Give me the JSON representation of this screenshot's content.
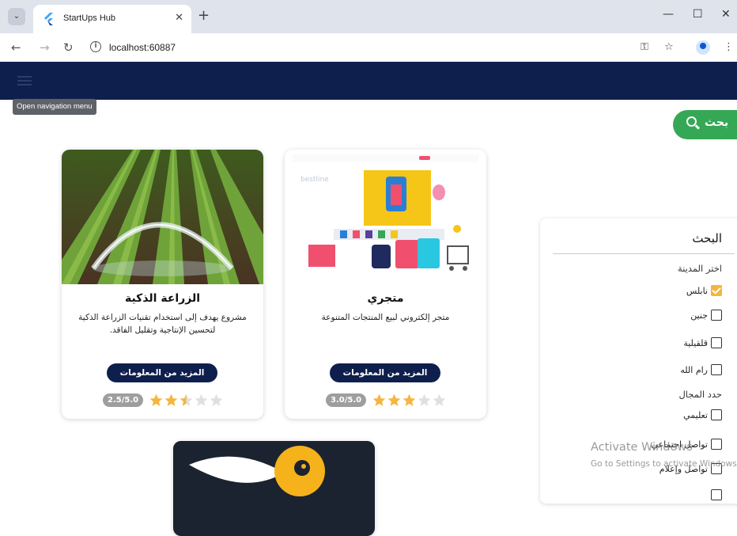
{
  "browser": {
    "tab_title": "StartUps Hub",
    "url": "localhost:60887"
  },
  "appbar": {
    "tooltip": "Open navigation menu"
  },
  "search": {
    "button_label": "بحث"
  },
  "cards": [
    {
      "title": "الزراعة الذكية",
      "description": "مشروع يهدف إلى استخدام تقنيات الزراعة الذكية لتحسين الإنتاجية وتقليل الفاقد.",
      "button": "المزيد من المعلومات",
      "rating_text": "2.5/5.0",
      "rating": 2.5
    },
    {
      "title": "متجري",
      "description": "متجر إلكتروني لبيع المنتجات المتنوعة",
      "button": "المزيد من المعلومات",
      "rating_text": "3.0/5.0",
      "rating": 3.0
    }
  ],
  "filters": {
    "title": "البحث",
    "city_label": "اختر المدينة",
    "cities": [
      {
        "label": "نابلس",
        "checked": true
      },
      {
        "label": "جنين",
        "checked": false
      },
      {
        "label": "قلقيلية",
        "checked": false
      },
      {
        "label": "رام الله",
        "checked": false
      }
    ],
    "field_label": "حدد المجال",
    "fields": [
      {
        "label": "تعليمي",
        "checked": false
      },
      {
        "label": "تواصل اجتماعي",
        "checked": false
      },
      {
        "label": "تواصل وإعلام",
        "checked": false
      }
    ]
  },
  "watermark": {
    "line1": "Activate Windows",
    "line2": "Go to Settings to activate Windows."
  },
  "colors": {
    "appbar": "#0f1f4d",
    "accent_green": "#35a855",
    "star": "#f4b63f"
  }
}
